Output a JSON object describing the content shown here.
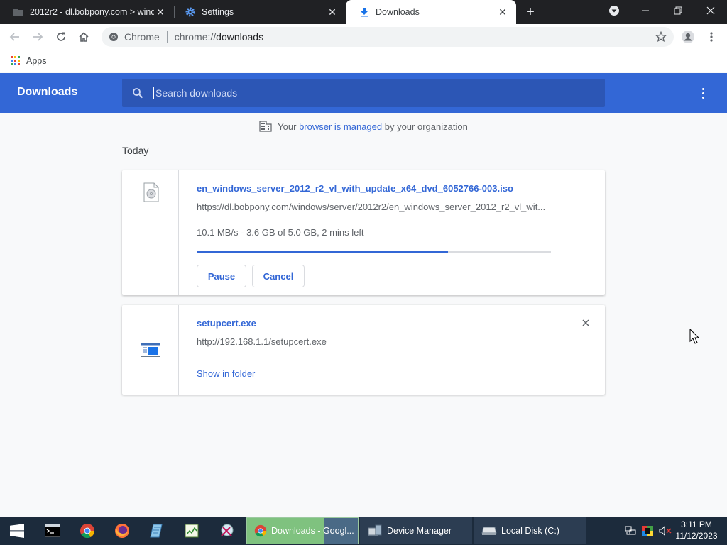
{
  "browser": {
    "tabs": [
      {
        "title": "2012r2 - dl.bobpony.com > wind",
        "icon": "folder-icon",
        "active": false
      },
      {
        "title": "Settings",
        "icon": "gear-icon",
        "active": false
      },
      {
        "title": "Downloads",
        "icon": "download-icon",
        "active": true
      }
    ],
    "omnibox": {
      "chip_label": "Chrome",
      "url_scheme": "chrome://",
      "url_path": "downloads"
    },
    "bookmarks": {
      "apps_label": "Apps"
    }
  },
  "downloads_page": {
    "title": "Downloads",
    "search_placeholder": "Search downloads",
    "managed_notice": {
      "prefix": "Your ",
      "link": "browser is managed",
      "suffix": " by your organization"
    },
    "date_group": "Today",
    "items": [
      {
        "filename": "en_windows_server_2012_r2_vl_with_update_x64_dvd_6052766-003.iso",
        "url": "https://dl.bobpony.com/windows/server/2012r2/en_windows_server_2012_r2_vl_wit...",
        "status": "10.1 MB/s - 3.6 GB of 5.0 GB, 2 mins left",
        "progress_percent": 71,
        "pause_label": "Pause",
        "cancel_label": "Cancel"
      },
      {
        "filename": "setupcert.exe",
        "url": "http://192.168.1.1/setupcert.exe",
        "show_in_folder_label": "Show in folder"
      }
    ]
  },
  "taskbar": {
    "tasks": [
      {
        "label": "Downloads - Googl...",
        "icon": "chrome-icon",
        "active": true
      },
      {
        "label": "Device Manager",
        "icon": "device-manager-icon",
        "active": false
      },
      {
        "label": "Local Disk (C:)",
        "icon": "drive-icon",
        "active": false
      }
    ],
    "clock": {
      "time": "3:11 PM",
      "date": "11/12/2023"
    }
  },
  "colors": {
    "accent": "#3367d6",
    "tabstrip": "#202124",
    "taskbar": "#1c2b3c"
  }
}
